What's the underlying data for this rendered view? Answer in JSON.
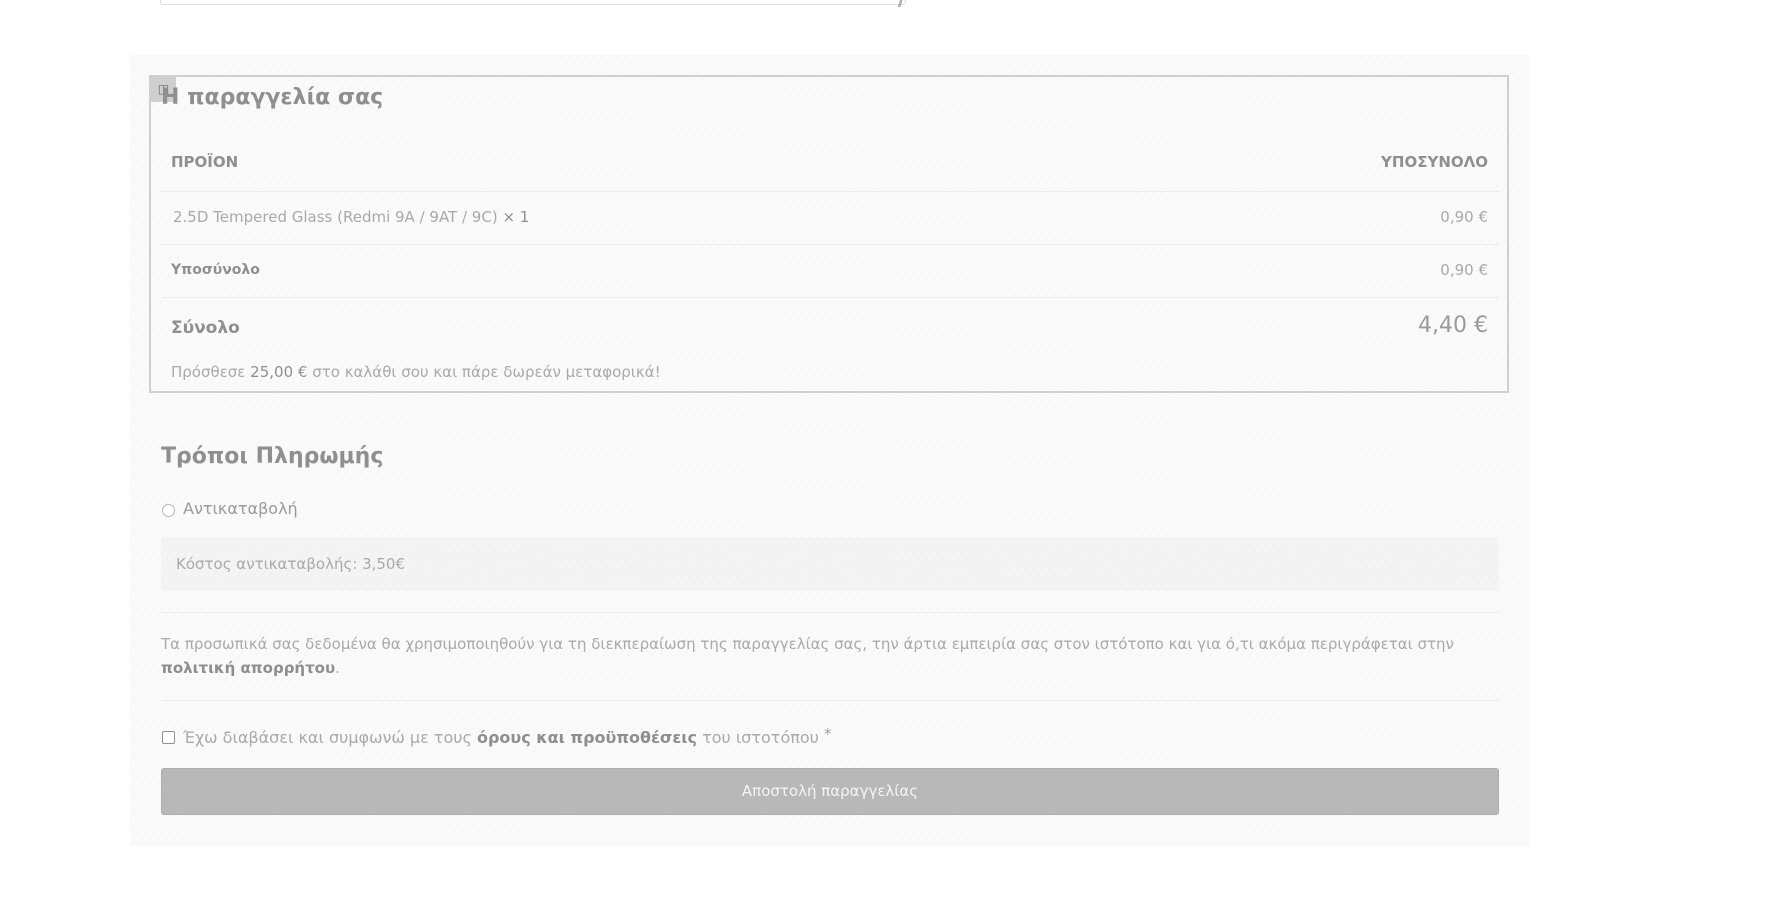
{
  "order_review": {
    "heading": "Η παραγγελία σας",
    "edit_icon": "◫",
    "columns": {
      "product": "ΠΡΟΪΟΝ",
      "subtotal": "ΥΠΟΣΥΝΟΛΟ"
    },
    "items": [
      {
        "name": "2.5D Tempered Glass (Redmi 9A / 9AT / 9C)",
        "qty": "× 1",
        "subtotal": "0,90 €"
      }
    ],
    "subtotal_label": "Υποσύνολο",
    "subtotal_value": "0,90 €",
    "total_label": "Σύνολο",
    "total_value": "4,40 €",
    "shipping_message": {
      "prefix": "Πρόσθεσε",
      "amount": "25,00 €",
      "suffix": "στο καλάθι σου και πάρε δωρεάν μεταφορικά!"
    }
  },
  "payment": {
    "heading": "Τρόποι Πληρωμής",
    "methods": [
      {
        "label": "Αντικαταβολή",
        "description": "Κόστος αντικαταβολής: 3,50€",
        "selected": false
      }
    ]
  },
  "privacy": {
    "text": "Τα προσωπικά σας δεδομένα θα χρησιμοποιηθούν για τη διεκπεραίωση της παραγγελίας σας, την άρτια εμπειρία σας στον ιστότοπο και για ό,τι ακόμα περιγράφεται στην",
    "link_text": "πολιτική απορρήτου",
    "end": "."
  },
  "terms": {
    "prefix": "Έχω διαβάσει και συμφωνώ με τους",
    "link_text": "όρους και προϋποθέσεις",
    "suffix": "του ιστοτόπου",
    "required_mark": "*",
    "checked": false
  },
  "place_order_label": "Αποστολή παραγγελίας",
  "textarea_resize_glyph": "//"
}
